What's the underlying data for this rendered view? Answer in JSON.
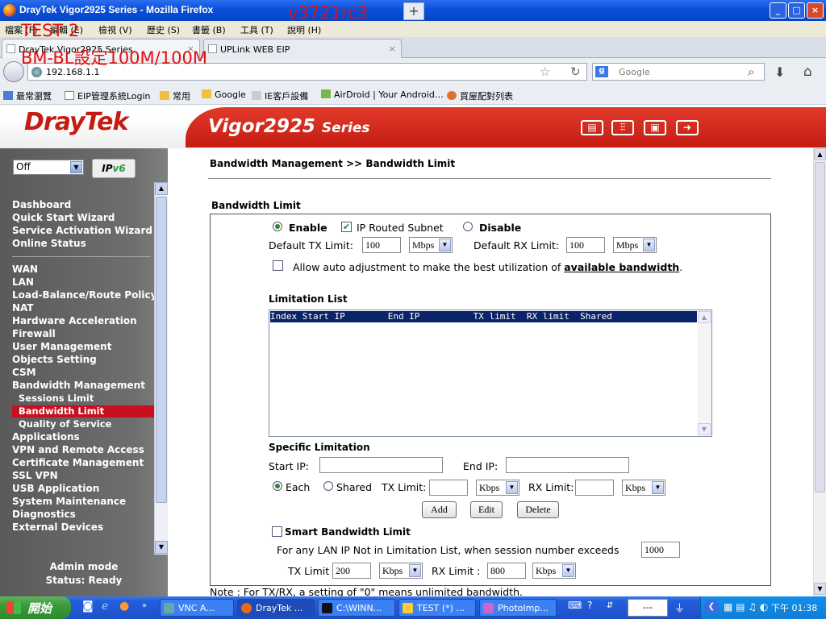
{
  "window": {
    "title": "DrayTek Vigor2925 Series - Mozilla Firefox",
    "min": "_",
    "max": "□",
    "close": "×"
  },
  "menubar": [
    "檔案 (F)",
    "編輯 (E)",
    "檢視 (V)",
    "歷史 (S)",
    "書籤 (B)",
    "工具 (T)",
    "說明 (H)"
  ],
  "tabs": [
    {
      "label": "DrayTek Vigor2925 Series",
      "close": "×"
    },
    {
      "label": "UPLink WEB EIP",
      "close": "×"
    }
  ],
  "newtab": "+",
  "url": "192.168.1.1",
  "search": {
    "engine": "g",
    "placeholder": "Google"
  },
  "bookmarks": [
    "最常瀏覽",
    "EIP管理系統Login",
    "常用",
    "Google",
    "IE客戶設備",
    "AirDroid | Your Android…",
    "買屋配對列表"
  ],
  "header": {
    "logo": "DrayTek",
    "product": "Vigor2925",
    "product_suffix": "Series"
  },
  "sidebar": {
    "ip_select": "Off",
    "ipv6_badge_a": "IP",
    "ipv6_badge_b": "v6",
    "groups": [
      [
        "Dashboard",
        "Quick Start Wizard",
        "Service Activation Wizard",
        "Online Status"
      ],
      [
        "WAN",
        "LAN",
        "Load-Balance/Route Policy",
        "NAT",
        "Hardware Acceleration",
        "Firewall",
        "User Management",
        "Objects Setting",
        "CSM",
        "Bandwidth Management"
      ],
      [
        "Sessions Limit",
        "Bandwidth Limit",
        "Quality of Service"
      ],
      [
        "Applications",
        "VPN and Remote Access",
        "Certificate Management",
        "SSL VPN",
        "USB Application",
        "System Maintenance",
        "Diagnostics",
        "External Devices"
      ]
    ],
    "selected": "Bandwidth Limit",
    "admin_mode": "Admin mode",
    "status": "Status: Ready"
  },
  "main": {
    "breadcrumb": "Bandwidth Management >> Bandwidth Limit",
    "section_title": "Bandwidth Limit",
    "mode": {
      "enable": "Enable",
      "ip_routed": "IP Routed Subnet",
      "disable": "Disable"
    },
    "default_tx_label": "Default TX Limit:",
    "default_tx_value": "100",
    "default_tx_unit": "Mbps",
    "default_rx_label": "Default RX Limit:",
    "default_rx_value": "100",
    "default_rx_unit": "Mbps",
    "auto_adjust_prefix": "Allow auto adjustment to make the best utilization of ",
    "auto_adjust_link": "available bandwidth",
    "auto_adjust_suffix": ".",
    "limitation_list_title": "Limitation List",
    "list_header": "Index Start IP        End IP          TX limit  RX limit  Shared",
    "specific_title": "Specific Limitation",
    "start_ip_label": "Start IP:",
    "end_ip_label": "End IP:",
    "each_label": "Each",
    "shared_label": "Shared",
    "tx_limit_label": "TX Limit:",
    "rx_limit_label": "RX Limit:",
    "spec_tx_unit": "Kbps",
    "spec_rx_unit": "Kbps",
    "add_btn": "Add",
    "edit_btn": "Edit",
    "delete_btn": "Delete",
    "smart_title": "Smart Bandwidth Limit",
    "smart_desc": "For any LAN IP Not in Limitation List, when session number exceeds",
    "smart_sessions": "1000",
    "smart_tx_label": "TX Limit :",
    "smart_tx_value": "200",
    "smart_tx_unit": "Kbps",
    "smart_rx_label": "RX Limit :",
    "smart_rx_value": "800",
    "smart_rx_unit": "Kbps",
    "note": "Note : For TX/RX, a setting of \"0\" means unlimited bandwidth."
  },
  "taskbar": {
    "start": "開始",
    "items": [
      "VNC A...",
      "DrayTek ...",
      "C:\\WINN...",
      "TEST (*) ...",
      "PhotoImp..."
    ],
    "box": "---",
    "clock": "下午 01:38"
  },
  "annotations": {
    "version": "v3721rc3",
    "test": "TEST 2",
    "setting": "BM-BL設定100M/100M"
  },
  "colors": {
    "brand_red": "#c41c12",
    "nav_selected": "#c8101e",
    "list_header": "#0a246a"
  }
}
